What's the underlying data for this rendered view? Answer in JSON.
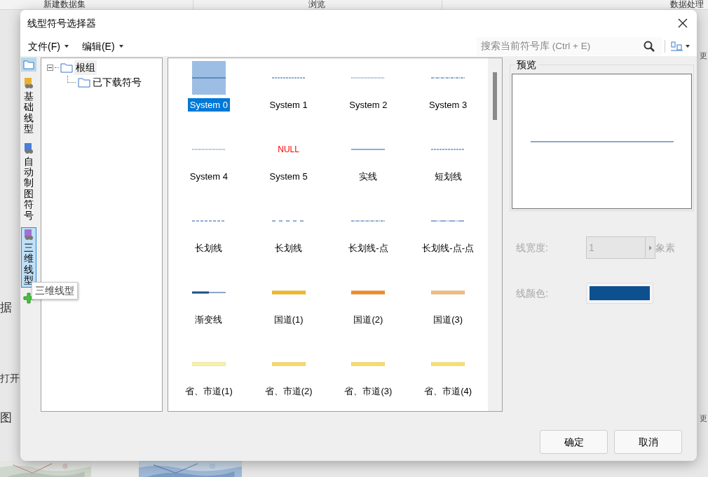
{
  "background_app": {
    "toolbar": [
      "新建数据集",
      "浏览",
      "数据处理"
    ],
    "left_texts": [
      "据",
      "打开",
      "图"
    ],
    "right_texts": [
      "更",
      "更"
    ],
    "thumbnails": [
      {
        "kind": "picture"
      },
      {
        "kind": "picture"
      }
    ]
  },
  "window": {
    "title": "线型符号选择器"
  },
  "menu": [
    {
      "label": "文件(F)"
    },
    {
      "label": "编辑(E)"
    }
  ],
  "search": {
    "placeholder": "搜索当前符号库 (Ctrl + E)"
  },
  "side_tabs": [
    {
      "kind": "folder",
      "selected": false
    },
    {
      "kind": "library",
      "label": "基础线型",
      "color": "#e8b030",
      "selected": false
    },
    {
      "kind": "library",
      "label": "自动制图符号",
      "color": "#4a7fd8",
      "selected": false
    },
    {
      "kind": "library",
      "label": "三维线型",
      "color": "#a070d0",
      "selected": true
    }
  ],
  "tooltip": "三维线型",
  "tree": [
    {
      "label": "根组",
      "expanded": true,
      "children": [
        {
          "label": "已下载符号"
        }
      ]
    }
  ],
  "symbol_rows": [
    [
      {
        "label": "System 0",
        "kind": "hatched",
        "selected": true
      },
      {
        "label": "System 1",
        "kind": "dashed",
        "selected": false
      },
      {
        "label": "System 2",
        "kind": "dotted",
        "selected": false
      },
      {
        "label": "System 3",
        "kind": "dashdot",
        "selected": false
      }
    ],
    [
      {
        "label": "System 4",
        "kind": "dotted",
        "selected": false
      },
      {
        "label": "System 5",
        "kind": "null",
        "text": "NULL",
        "selected": false
      },
      {
        "label": "实线",
        "kind": "solid",
        "selected": false
      },
      {
        "label": "短划线",
        "kind": "dashed",
        "selected": false
      }
    ],
    [
      {
        "label": "长划线",
        "kind": "longdash",
        "selected": false
      },
      {
        "label": "长划线",
        "kind": "gapdash",
        "selected": false
      },
      {
        "label": "长划线-点",
        "kind": "dashdot",
        "selected": false
      },
      {
        "label": "长划线-点-点",
        "kind": "dashdotdot",
        "selected": false
      }
    ],
    [
      {
        "label": "渐变线",
        "kind": "taper",
        "selected": false
      },
      {
        "label": "国道(1)",
        "kind": "band",
        "color": "#f0b820",
        "selected": false
      },
      {
        "label": "国道(2)",
        "kind": "band",
        "color": "#f08a20",
        "selected": false
      },
      {
        "label": "国道(3)",
        "kind": "band",
        "color": "#f2bb78",
        "selected": false
      }
    ],
    [
      {
        "label": "省、市道(1)",
        "kind": "band",
        "color": "#f6f2a0",
        "selected": false
      },
      {
        "label": "省、市道(2)",
        "kind": "band",
        "color": "#f8d860",
        "selected": false
      },
      {
        "label": "省、市道(3)",
        "kind": "band",
        "color": "#f8dc60",
        "selected": false
      },
      {
        "label": "省、市道(4)",
        "kind": "band",
        "color": "#f8e068",
        "selected": false
      }
    ]
  ],
  "preview": {
    "title": "预览"
  },
  "line_width": {
    "label": "线宽度:",
    "value": "1",
    "unit": "象素",
    "disabled": true
  },
  "line_color": {
    "label": "线颜色:",
    "color": "#0d5090",
    "disabled": true
  },
  "buttons": [
    "确定",
    "取消"
  ]
}
